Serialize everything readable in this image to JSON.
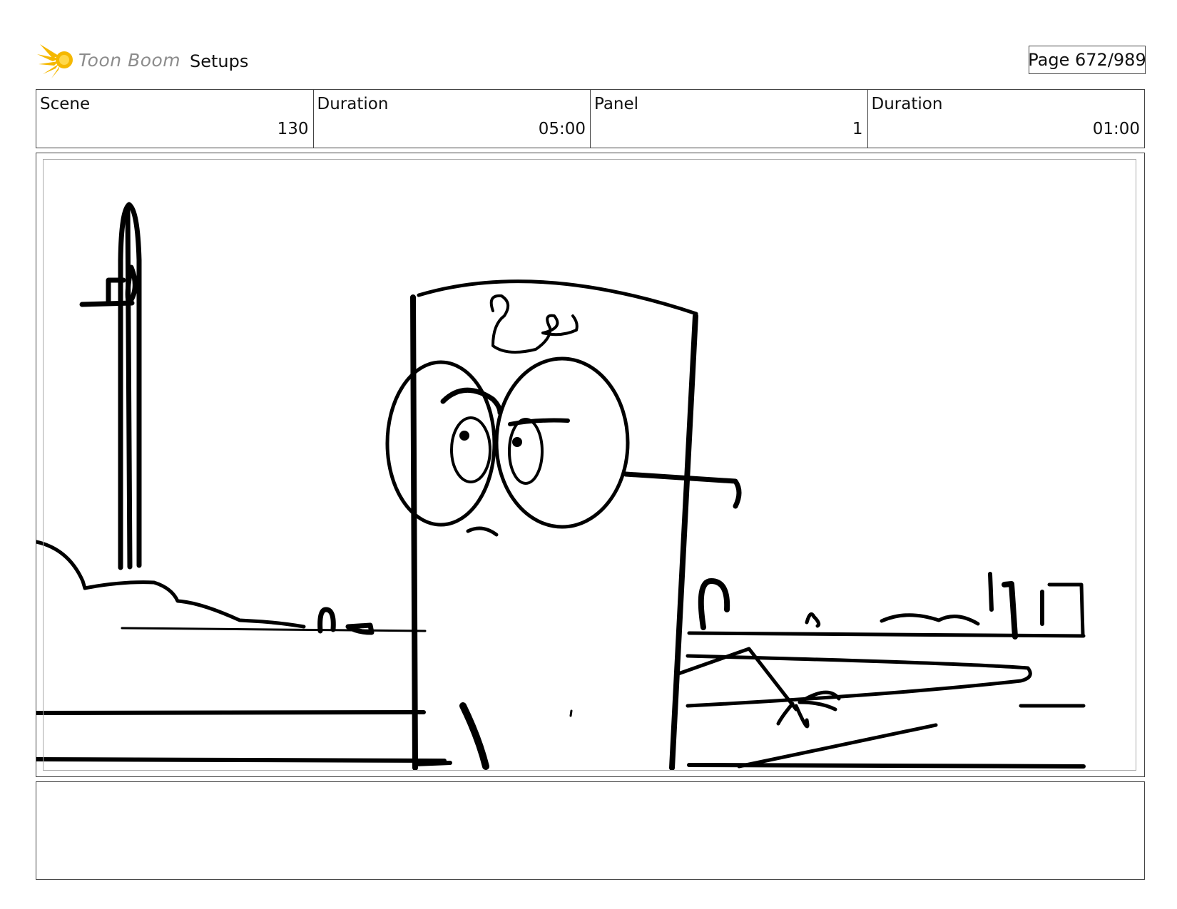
{
  "header": {
    "logo_text": "Toon Boom",
    "title": "Setups",
    "page_label": "Page 672/989"
  },
  "info": {
    "scene_label": "Scene",
    "scene_value": "130",
    "scene_duration_label": "Duration",
    "scene_duration_value": "05:00",
    "panel_label": "Panel",
    "panel_value": "1",
    "panel_duration_label": "Duration",
    "panel_duration_value": "01:00"
  },
  "notes": {
    "text": ""
  },
  "colors": {
    "logo_star": "#f5b800",
    "logo_text": "#8c8c8c",
    "border": "#444444"
  }
}
